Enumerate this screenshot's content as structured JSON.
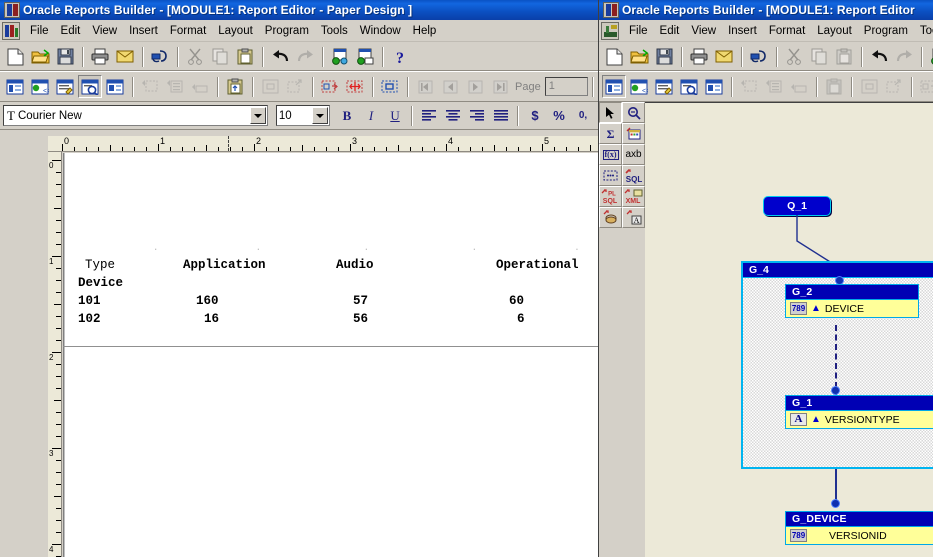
{
  "left_window": {
    "title": "Oracle Reports Builder - [MODULE1: Report Editor - Paper Design ]",
    "app_icon": "oracle-reports-icon",
    "menu": [
      {
        "label": "File"
      },
      {
        "label": "Edit"
      },
      {
        "label": "View"
      },
      {
        "label": "Insert"
      },
      {
        "label": "Format"
      },
      {
        "label": "Layout"
      },
      {
        "label": "Program"
      },
      {
        "label": "Tools"
      },
      {
        "label": "Window"
      },
      {
        "label": "Help"
      }
    ],
    "toolbar_standard": [
      {
        "name": "new-icon"
      },
      {
        "name": "open-icon"
      },
      {
        "name": "save-icon"
      },
      {
        "sep": true
      },
      {
        "name": "print-icon"
      },
      {
        "name": "mail-icon"
      },
      {
        "sep": true
      },
      {
        "name": "run-paper-icon"
      },
      {
        "sep": true
      },
      {
        "name": "cut-icon",
        "disabled": true
      },
      {
        "name": "copy-icon",
        "disabled": true
      },
      {
        "name": "paste-icon"
      },
      {
        "sep": true
      },
      {
        "name": "undo-icon"
      },
      {
        "name": "redo-icon",
        "disabled": true
      },
      {
        "sep": true
      },
      {
        "name": "web-source-icon"
      },
      {
        "name": "paper-source-icon"
      },
      {
        "sep": true
      },
      {
        "name": "help-icon"
      }
    ],
    "toolbar_view": [
      {
        "name": "data-model-view-icon"
      },
      {
        "name": "web-source-view-icon"
      },
      {
        "name": "paper-layout-view-icon"
      },
      {
        "name": "paper-design-view-icon",
        "pressed": true
      },
      {
        "name": "parameter-form-view-icon"
      },
      {
        "sep": true
      },
      {
        "name": "insert-field-icon",
        "disabled": true
      },
      {
        "name": "insert-list-icon",
        "disabled": true
      },
      {
        "name": "insert-box-icon",
        "disabled": true
      },
      {
        "sep": true
      },
      {
        "name": "paste-layout-icon"
      },
      {
        "sep": true
      },
      {
        "name": "select-parent-frame-icon",
        "disabled": true
      },
      {
        "name": "expand-child-icon",
        "disabled": true
      },
      {
        "sep": true
      },
      {
        "name": "flex-mode-icon"
      },
      {
        "name": "confine-mode-icon"
      },
      {
        "sep": true
      },
      {
        "name": "object-select-icon"
      },
      {
        "sep": true
      },
      {
        "name": "first-page-icon",
        "disabled": true
      },
      {
        "name": "previous-page-icon",
        "disabled": true
      },
      {
        "name": "next-page-icon",
        "disabled": true
      },
      {
        "name": "last-page-icon",
        "disabled": true
      }
    ],
    "page_label": "Page",
    "page_value": "1",
    "format_bar": {
      "font_icon": "font-type-icon",
      "font_name": "Courier New",
      "font_size": "10",
      "bold_label": "B",
      "italic_label": "I",
      "underline_label": "U",
      "align_left": "align-left-icon",
      "align_center": "align-center-icon",
      "align_right": "align-right-icon",
      "align_justify": "align-justify-icon",
      "currency_label": "$",
      "percent_label": "%",
      "comma_label": "0,"
    },
    "object_palette": [
      {
        "name": "select-tool-icon",
        "selected": true
      },
      {
        "name": "magnify-tool-icon"
      },
      {
        "name": "rectangle-tool-icon"
      },
      {
        "name": "line-tool-icon"
      },
      {
        "name": "ellipse-tool-icon"
      },
      {
        "name": "arc-tool-icon"
      },
      {
        "name": "rounded-rectangle-tool-icon"
      },
      {
        "name": "text-tool-icon"
      },
      {
        "name": "list-tool-icon"
      },
      {
        "name": "link-file-tool-icon"
      }
    ],
    "text_tool_glyph": "T",
    "ruler_unit_marks": [
      "0",
      "1",
      "2",
      "3",
      "4",
      "5"
    ],
    "vruler_marks": [
      "0",
      "1"
    ],
    "report": {
      "dot_markers": ". . . . .",
      "columns": [
        "Type",
        "Application",
        "Audio",
        "Operational"
      ],
      "subheader": "Device",
      "rows": [
        {
          "device": "101",
          "application": "160",
          "audio": "57",
          "operational": "60"
        },
        {
          "device": "102",
          "application": "16",
          "audio": "56",
          "operational": "6"
        }
      ]
    }
  },
  "right_window": {
    "title": "Oracle Reports Builder - [MODULE1: Report Editor",
    "app_icon": "oracle-reports-icon",
    "menu_icon": "data-model-icon",
    "menu": [
      {
        "label": "File"
      },
      {
        "label": "Edit"
      },
      {
        "label": "View"
      },
      {
        "label": "Insert"
      },
      {
        "label": "Format"
      },
      {
        "label": "Layout"
      },
      {
        "label": "Program"
      },
      {
        "label": "Tools"
      }
    ],
    "toolbar_standard": [
      {
        "name": "new-icon"
      },
      {
        "name": "open-icon"
      },
      {
        "name": "save-icon"
      },
      {
        "sep": true
      },
      {
        "name": "print-icon"
      },
      {
        "name": "mail-icon"
      },
      {
        "sep": true
      },
      {
        "name": "run-paper-icon"
      },
      {
        "sep": true
      },
      {
        "name": "cut-icon",
        "disabled": true
      },
      {
        "name": "copy-icon",
        "disabled": true
      },
      {
        "name": "paste-icon",
        "disabled": true
      },
      {
        "sep": true
      },
      {
        "name": "undo-icon"
      },
      {
        "name": "redo-icon",
        "disabled": true
      },
      {
        "sep": true
      },
      {
        "name": "web-source-icon"
      }
    ],
    "toolbar_view": [
      {
        "name": "data-model-view-icon",
        "pressed": true
      },
      {
        "name": "web-source-view-icon"
      },
      {
        "name": "paper-layout-view-icon"
      },
      {
        "name": "paper-design-view-icon"
      },
      {
        "name": "parameter-form-view-icon"
      },
      {
        "sep": true
      },
      {
        "name": "insert-field-icon",
        "disabled": true
      },
      {
        "name": "insert-list-icon",
        "disabled": true
      },
      {
        "name": "insert-box-icon",
        "disabled": true
      },
      {
        "sep": true
      },
      {
        "name": "paste-layout-icon",
        "disabled": true
      },
      {
        "sep": true
      },
      {
        "name": "select-parent-frame-icon",
        "disabled": true
      },
      {
        "name": "expand-child-icon",
        "disabled": true
      },
      {
        "sep": true
      },
      {
        "name": "flex-mode-icon",
        "disabled": true
      },
      {
        "name": "confine-mode-icon",
        "disabled": true
      }
    ],
    "tool_palette": [
      {
        "name": "select-tool-icon",
        "selected": true
      },
      {
        "name": "magnify-tool-icon"
      },
      {
        "name": "summary-column-tool-icon",
        "label": "Σ"
      },
      {
        "name": "query-tool-icon"
      },
      {
        "name": "formula-column-tool-icon",
        "label": "f(x)"
      },
      {
        "name": "cross-product-tool-icon",
        "label": "axb"
      },
      {
        "name": "group-tool-icon"
      },
      {
        "name": "sql-query-tool-icon",
        "label": "SQL"
      },
      {
        "name": "plsql-query-tool-icon",
        "label": "PL SQL"
      },
      {
        "name": "xml-query-tool-icon",
        "label": "XML"
      },
      {
        "name": "ref-cursor-query-tool-icon"
      },
      {
        "name": "text-query-tool-icon",
        "label": "A"
      }
    ],
    "data_model": {
      "query_node": {
        "label": "Q_1"
      },
      "container_group": {
        "label": "G_4"
      },
      "groups": [
        {
          "label": "G_2",
          "field": "DEVICE",
          "field_type": "number",
          "type_glyph": "789"
        },
        {
          "label": "G_1",
          "field": "VERSIONTYPE",
          "field_type": "character",
          "type_glyph": "A"
        },
        {
          "label": "G_DEVICE",
          "field": "VERSIONID",
          "field_type": "number",
          "type_glyph": "789"
        }
      ]
    }
  },
  "colors": {
    "titlebar_blue": "#0b52c4",
    "node_header_blue": "#0000b4",
    "node_border_cyan": "#00b4f0",
    "field_yellow": "#ffff99",
    "desktop_beige": "#ece9d8",
    "chrome_gray": "#d4d0c8"
  }
}
